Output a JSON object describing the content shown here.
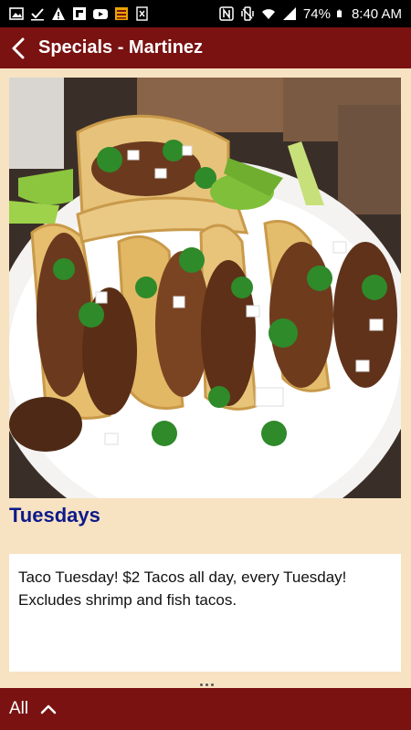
{
  "status_bar": {
    "battery": "74%",
    "time": "8:40 AM",
    "left_icons": [
      "gallery-icon",
      "check-icon",
      "warning-icon",
      "flipboard-icon",
      "youtube-icon",
      "news-icon",
      "exchange-icon"
    ],
    "right_icons": [
      "nfc-icon",
      "vibrate-icon",
      "wifi-icon",
      "signal-icon",
      "battery-icon"
    ]
  },
  "app_bar": {
    "title": "Specials - Martinez",
    "back_icon": "back-arrow-icon",
    "color": "#7a1212"
  },
  "special": {
    "day": "Tuesdays",
    "description": "Taco Tuesday! $2 Tacos all day, every Tuesday! Excludes shrimp and fish tacos.",
    "heading_color": "#0d1a8a"
  },
  "bottom_bar": {
    "filter_label": "All",
    "expand_icon": "chevron-up-icon"
  },
  "colors": {
    "background": "#f7e2c2",
    "brand": "#7a1212"
  }
}
